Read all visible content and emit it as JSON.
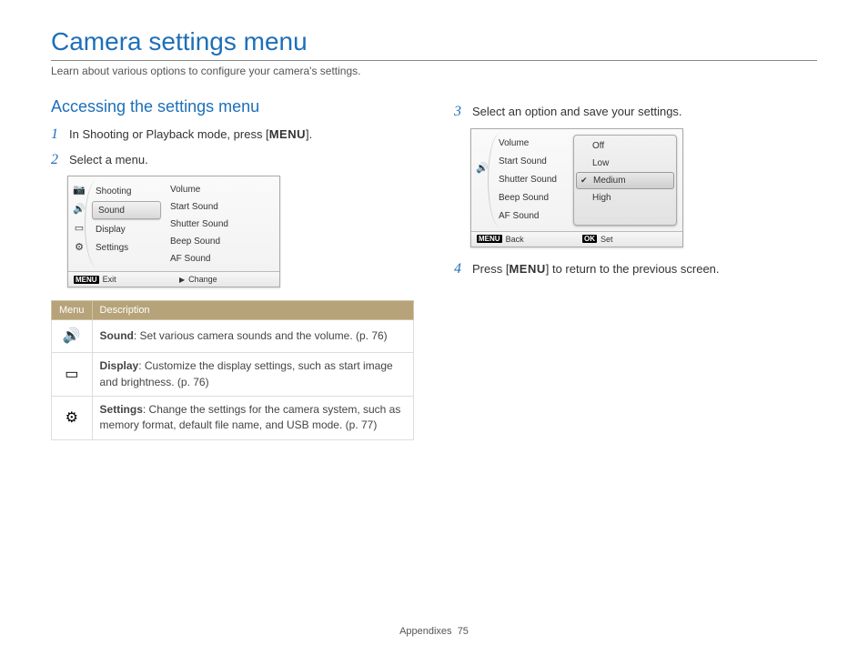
{
  "title": "Camera settings menu",
  "subtitle": "Learn about various options to configure your camera's settings.",
  "section_heading": "Accessing the settings menu",
  "steps": {
    "num1": "1",
    "text1_a": "In Shooting or Playback mode, press [",
    "text1_b": "].",
    "btn_menu": "MENU",
    "num2": "2",
    "text2": "Select a menu.",
    "num3": "3",
    "text3": "Select an option and save your settings.",
    "num4": "4",
    "text4_a": "Press [",
    "text4_b": "] to return to the previous screen."
  },
  "screen1": {
    "items": {
      "shooting": "Shooting",
      "sound": "Sound",
      "display": "Display",
      "settings": "Settings"
    },
    "opts": {
      "volume": "Volume",
      "start_sound": "Start Sound",
      "shutter_sound": "Shutter Sound",
      "beep_sound": "Beep Sound",
      "af_sound": "AF Sound"
    },
    "footer_left_icon": "MENU",
    "footer_left": "Exit",
    "footer_right_icon": "▶",
    "footer_right": "Change"
  },
  "screen2": {
    "opts": {
      "volume": "Volume",
      "start_sound": "Start Sound",
      "shutter_sound": "Shutter Sound",
      "beep_sound": "Beep Sound",
      "af_sound": "AF Sound"
    },
    "values": {
      "off": "Off",
      "low": "Low",
      "medium": "Medium",
      "high": "High"
    },
    "footer_left_icon": "MENU",
    "footer_left": "Back",
    "footer_right_icon": "OK",
    "footer_right": "Set"
  },
  "table": {
    "head_menu": "Menu",
    "head_desc": "Description",
    "rows": [
      {
        "label": "Sound",
        "desc": ": Set various camera sounds and the volume. (p. 76)"
      },
      {
        "label": "Display",
        "desc": ": Customize the display settings, such as start image and brightness. (p. 76)"
      },
      {
        "label": "Settings",
        "desc": ": Change the settings for the camera system, such as memory format, default file name, and USB mode. (p. 77)"
      }
    ]
  },
  "footer": {
    "section": "Appendixes",
    "page": "75"
  }
}
